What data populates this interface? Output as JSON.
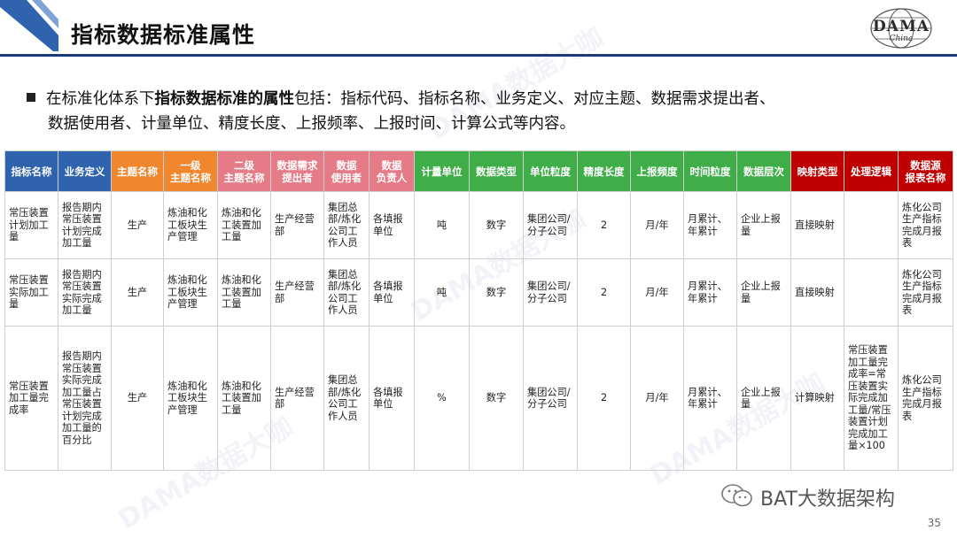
{
  "slide": {
    "title": "指标数据标准属性",
    "logo_text": "DAMA",
    "logo_sub": "China",
    "bullet": {
      "prefix": "在标准化体系下",
      "bold": "指标数据标准的属性",
      "rest_line1": "包括：指标代码、指标名称、业务定义、对应主题、数据需求提出者、",
      "line2": "数据使用者、计量单位、精度长度、上报频率、上报时间、计算公式等内容。"
    },
    "brand": "BAT大数据架构",
    "page_number": "35",
    "watermark": "DAMA数据大咖"
  },
  "colors": {
    "blue": "#2f63ad",
    "orange": "#f0872e",
    "pink": "#e57b87",
    "green": "#3fae49",
    "red": "#c00000",
    "rule": "#1a3a7a"
  },
  "table": {
    "headers": [
      {
        "label": "指标名称",
        "color": "blue"
      },
      {
        "label": "业务定义",
        "color": "blue"
      },
      {
        "label": "主题名称",
        "color": "orange"
      },
      {
        "label": "一级\n主题名称",
        "color": "orange"
      },
      {
        "label": "二级\n主题名称",
        "color": "pink"
      },
      {
        "label": "数据需求\n提出者",
        "color": "pink"
      },
      {
        "label": "数据\n使用者",
        "color": "pink"
      },
      {
        "label": "数据\n负责人",
        "color": "pink"
      },
      {
        "label": "计量单位",
        "color": "green"
      },
      {
        "label": "数据类型",
        "color": "green"
      },
      {
        "label": "单位粒度",
        "color": "green"
      },
      {
        "label": "精度长度",
        "color": "green"
      },
      {
        "label": "上报频度",
        "color": "green"
      },
      {
        "label": "时间粒度",
        "color": "green"
      },
      {
        "label": "数据层次",
        "color": "green"
      },
      {
        "label": "映射类型",
        "color": "red"
      },
      {
        "label": "处理逻辑",
        "color": "red"
      },
      {
        "label": "数据源\n报表名称",
        "color": "red"
      }
    ],
    "rows": [
      [
        "常压装置计划加工量",
        "报告期内常压装置计划完成加工量",
        "生产",
        "炼油和化工板块生产管理",
        "炼油和化工装置加工量",
        "生产经营部",
        "集团总部/炼化公司工作人员",
        "各填报单位",
        "吨",
        "数字",
        "集团公司/分子公司",
        "2",
        "月/年",
        "月累计、年累计",
        "企业上报量",
        "直接映射",
        "",
        "炼化公司生产指标完成月报表"
      ],
      [
        "常压装置实际加工量",
        "报告期内常压装置实际完成加工量",
        "生产",
        "炼油和化工板块生产管理",
        "炼油和化工装置加工量",
        "生产经营部",
        "集团总部/炼化公司工作人员",
        "各填报单位",
        "吨",
        "数字",
        "集团公司/分子公司",
        "2",
        "月/年",
        "月累计、年累计",
        "企业上报量",
        "直接映射",
        "",
        "炼化公司生产指标完成月报表"
      ],
      [
        "常压装置加工量完成率",
        "报告期内常压装置实际完成加工量占常压装置计划完成加工量的百分比",
        "生产",
        "炼油和化工板块生产管理",
        "炼油和化工装置加工量",
        "生产经营部",
        "集团总部/炼化公司工作人员",
        "各填报单位",
        "%",
        "数字",
        "集团公司/分子公司",
        "2",
        "月/年",
        "月累计、年累计",
        "企业上报量",
        "计算映射",
        "常压装置加工量完成率=常压装置实际完成加工量/常压装置计划完成加工量×100",
        "炼化公司生产指标完成月报表"
      ]
    ]
  }
}
